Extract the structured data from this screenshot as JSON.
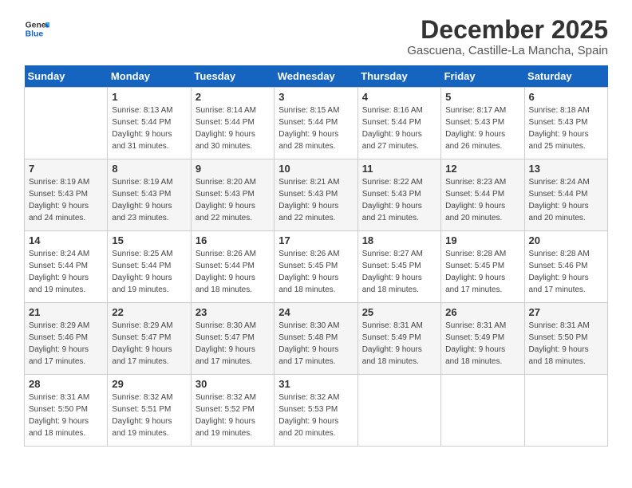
{
  "logo": {
    "line1": "General",
    "line2": "Blue"
  },
  "title": "December 2025",
  "subtitle": "Gascuena, Castille-La Mancha, Spain",
  "days_of_week": [
    "Sunday",
    "Monday",
    "Tuesday",
    "Wednesday",
    "Thursday",
    "Friday",
    "Saturday"
  ],
  "weeks": [
    [
      {
        "day": "",
        "info": ""
      },
      {
        "day": "1",
        "info": "Sunrise: 8:13 AM\nSunset: 5:44 PM\nDaylight: 9 hours\nand 31 minutes."
      },
      {
        "day": "2",
        "info": "Sunrise: 8:14 AM\nSunset: 5:44 PM\nDaylight: 9 hours\nand 30 minutes."
      },
      {
        "day": "3",
        "info": "Sunrise: 8:15 AM\nSunset: 5:44 PM\nDaylight: 9 hours\nand 28 minutes."
      },
      {
        "day": "4",
        "info": "Sunrise: 8:16 AM\nSunset: 5:44 PM\nDaylight: 9 hours\nand 27 minutes."
      },
      {
        "day": "5",
        "info": "Sunrise: 8:17 AM\nSunset: 5:43 PM\nDaylight: 9 hours\nand 26 minutes."
      },
      {
        "day": "6",
        "info": "Sunrise: 8:18 AM\nSunset: 5:43 PM\nDaylight: 9 hours\nand 25 minutes."
      }
    ],
    [
      {
        "day": "7",
        "info": "Sunrise: 8:19 AM\nSunset: 5:43 PM\nDaylight: 9 hours\nand 24 minutes."
      },
      {
        "day": "8",
        "info": "Sunrise: 8:19 AM\nSunset: 5:43 PM\nDaylight: 9 hours\nand 23 minutes."
      },
      {
        "day": "9",
        "info": "Sunrise: 8:20 AM\nSunset: 5:43 PM\nDaylight: 9 hours\nand 22 minutes."
      },
      {
        "day": "10",
        "info": "Sunrise: 8:21 AM\nSunset: 5:43 PM\nDaylight: 9 hours\nand 22 minutes."
      },
      {
        "day": "11",
        "info": "Sunrise: 8:22 AM\nSunset: 5:43 PM\nDaylight: 9 hours\nand 21 minutes."
      },
      {
        "day": "12",
        "info": "Sunrise: 8:23 AM\nSunset: 5:44 PM\nDaylight: 9 hours\nand 20 minutes."
      },
      {
        "day": "13",
        "info": "Sunrise: 8:24 AM\nSunset: 5:44 PM\nDaylight: 9 hours\nand 20 minutes."
      }
    ],
    [
      {
        "day": "14",
        "info": "Sunrise: 8:24 AM\nSunset: 5:44 PM\nDaylight: 9 hours\nand 19 minutes."
      },
      {
        "day": "15",
        "info": "Sunrise: 8:25 AM\nSunset: 5:44 PM\nDaylight: 9 hours\nand 19 minutes."
      },
      {
        "day": "16",
        "info": "Sunrise: 8:26 AM\nSunset: 5:44 PM\nDaylight: 9 hours\nand 18 minutes."
      },
      {
        "day": "17",
        "info": "Sunrise: 8:26 AM\nSunset: 5:45 PM\nDaylight: 9 hours\nand 18 minutes."
      },
      {
        "day": "18",
        "info": "Sunrise: 8:27 AM\nSunset: 5:45 PM\nDaylight: 9 hours\nand 18 minutes."
      },
      {
        "day": "19",
        "info": "Sunrise: 8:28 AM\nSunset: 5:45 PM\nDaylight: 9 hours\nand 17 minutes."
      },
      {
        "day": "20",
        "info": "Sunrise: 8:28 AM\nSunset: 5:46 PM\nDaylight: 9 hours\nand 17 minutes."
      }
    ],
    [
      {
        "day": "21",
        "info": "Sunrise: 8:29 AM\nSunset: 5:46 PM\nDaylight: 9 hours\nand 17 minutes."
      },
      {
        "day": "22",
        "info": "Sunrise: 8:29 AM\nSunset: 5:47 PM\nDaylight: 9 hours\nand 17 minutes."
      },
      {
        "day": "23",
        "info": "Sunrise: 8:30 AM\nSunset: 5:47 PM\nDaylight: 9 hours\nand 17 minutes."
      },
      {
        "day": "24",
        "info": "Sunrise: 8:30 AM\nSunset: 5:48 PM\nDaylight: 9 hours\nand 17 minutes."
      },
      {
        "day": "25",
        "info": "Sunrise: 8:31 AM\nSunset: 5:49 PM\nDaylight: 9 hours\nand 18 minutes."
      },
      {
        "day": "26",
        "info": "Sunrise: 8:31 AM\nSunset: 5:49 PM\nDaylight: 9 hours\nand 18 minutes."
      },
      {
        "day": "27",
        "info": "Sunrise: 8:31 AM\nSunset: 5:50 PM\nDaylight: 9 hours\nand 18 minutes."
      }
    ],
    [
      {
        "day": "28",
        "info": "Sunrise: 8:31 AM\nSunset: 5:50 PM\nDaylight: 9 hours\nand 18 minutes."
      },
      {
        "day": "29",
        "info": "Sunrise: 8:32 AM\nSunset: 5:51 PM\nDaylight: 9 hours\nand 19 minutes."
      },
      {
        "day": "30",
        "info": "Sunrise: 8:32 AM\nSunset: 5:52 PM\nDaylight: 9 hours\nand 19 minutes."
      },
      {
        "day": "31",
        "info": "Sunrise: 8:32 AM\nSunset: 5:53 PM\nDaylight: 9 hours\nand 20 minutes."
      },
      {
        "day": "",
        "info": ""
      },
      {
        "day": "",
        "info": ""
      },
      {
        "day": "",
        "info": ""
      }
    ]
  ]
}
